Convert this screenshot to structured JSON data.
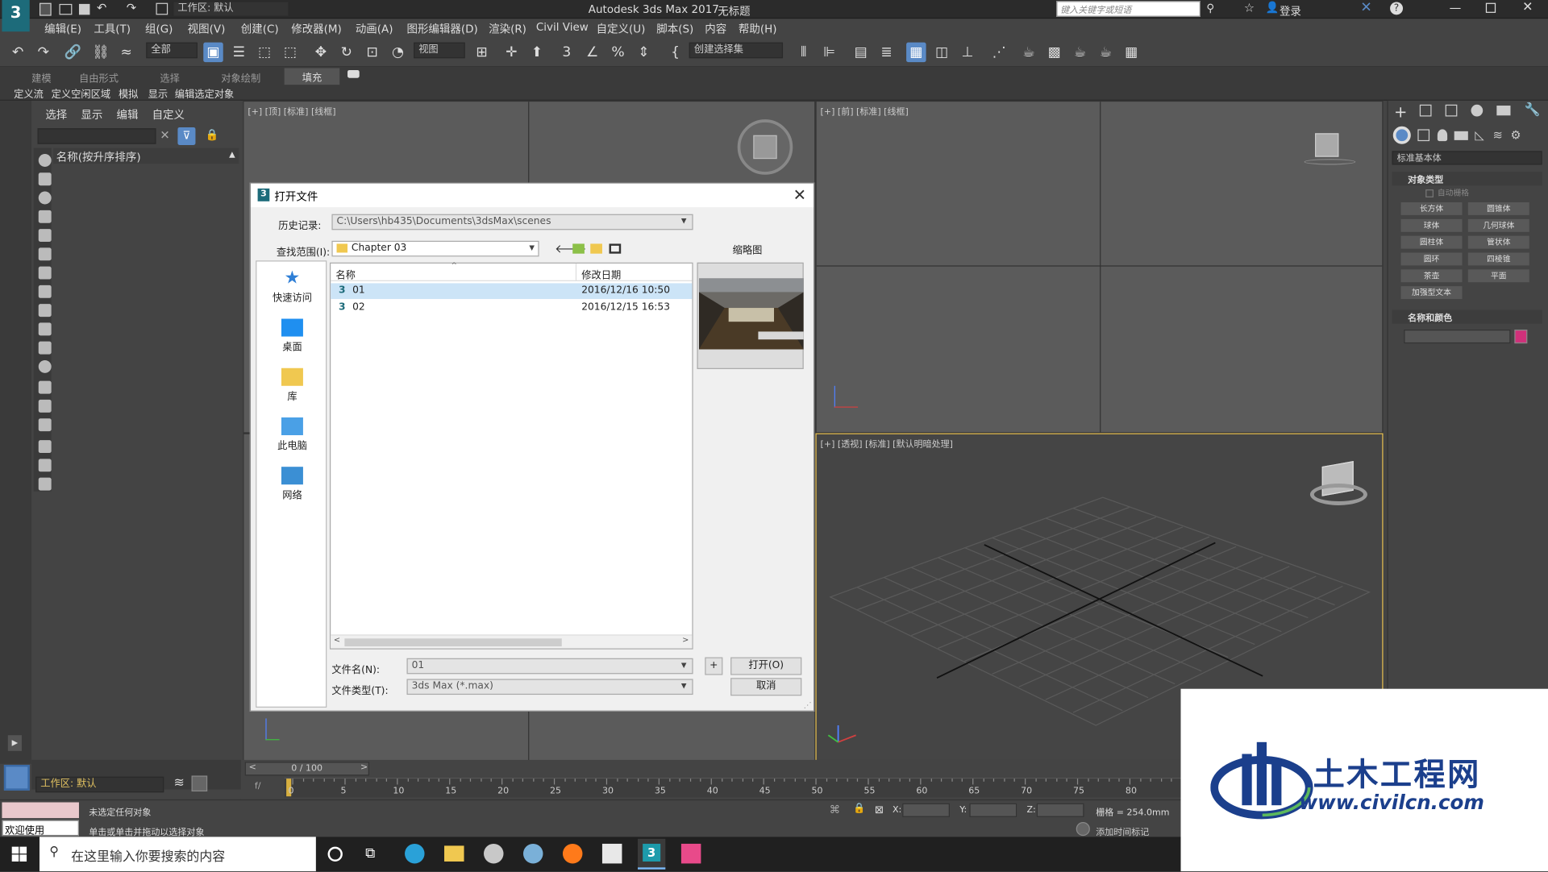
{
  "app": {
    "title": "Autodesk 3ds Max 2017",
    "doc_title": "无标题",
    "workspace_label": "工作区: 默认",
    "search_placeholder": "键入关键字或短语",
    "login": "登录"
  },
  "menu": [
    "编辑(E)",
    "工具(T)",
    "组(G)",
    "视图(V)",
    "创建(C)",
    "修改器(M)",
    "动画(A)",
    "图形编辑器(D)",
    "渲染(R)",
    "Civil View",
    "自定义(U)",
    "脚本(S)",
    "内容",
    "帮助(H)"
  ],
  "toolbar": {
    "selection_filter": "全部",
    "ref_coord": "视图",
    "named_selection": "创建选择集"
  },
  "ribbon": {
    "tabs": [
      "建模",
      "自由形式",
      "选择",
      "对象绘制",
      "填充"
    ],
    "subtabs": [
      "定义流",
      "定义空闲区域",
      "模拟",
      "显示",
      "编辑选定对象"
    ]
  },
  "explorer": {
    "tabs": [
      "选择",
      "显示",
      "编辑",
      "自定义"
    ],
    "column_header": "名称(按升序排序)",
    "workspace": "工作区: 默认"
  },
  "viewports": {
    "top": "[+] [顶] [标准] [线框]",
    "front": "[+] [前] [标准] [线框]",
    "perspective": "[+] [透视] [标准] [默认明暗处理]"
  },
  "command_panel": {
    "category": "标准基本体",
    "object_type_title": "对象类型",
    "autogrid": "自动栅格",
    "buttons": [
      "长方体",
      "圆锥体",
      "球体",
      "几何球体",
      "圆柱体",
      "管状体",
      "圆环",
      "四棱锥",
      "茶壶",
      "平面",
      "加强型文本"
    ],
    "name_color_title": "名称和颜色",
    "color": "#d0307a"
  },
  "timeline": {
    "frame_counter": "0 / 100",
    "ticks": [
      "0",
      "5",
      "10",
      "15",
      "20",
      "25",
      "30",
      "35",
      "40",
      "45",
      "50",
      "55",
      "60",
      "65",
      "70",
      "75",
      "80"
    ]
  },
  "status": {
    "maxscript": "欢迎使用 MAXSc",
    "line1": "未选定任何对象",
    "line2": "单击或单击并拖动以选择对象",
    "x_label": "X:",
    "y_label": "Y:",
    "z_label": "Z:",
    "grid": "栅格 = 254.0mm",
    "add_time_tag": "添加时间标记"
  },
  "dialog": {
    "title": "打开文件",
    "history_label": "历史记录:",
    "history_value": "C:\\Users\\hb435\\Documents\\3dsMax\\scenes",
    "lookin_label": "查找范围(I):",
    "lookin_value": "Chapter 03",
    "thumbnail_label": "缩略图",
    "places": [
      "快速访问",
      "桌面",
      "库",
      "此电脑",
      "网络"
    ],
    "columns": [
      "名称",
      "修改日期"
    ],
    "files": [
      {
        "name": "01",
        "date": "2016/12/16 10:50"
      },
      {
        "name": "02",
        "date": "2016/12/15 16:53"
      }
    ],
    "filename_label": "文件名(N):",
    "filename_value": "01",
    "filetype_label": "文件类型(T):",
    "filetype_value": "3ds Max (*.max)",
    "plus_label": "+",
    "open_label": "打开(O)",
    "cancel_label": "取消"
  },
  "taskbar": {
    "search_placeholder": "在这里输入你要搜索的内容"
  },
  "watermark": {
    "brand": "土木工程网",
    "url": "www.civilcn.com"
  }
}
